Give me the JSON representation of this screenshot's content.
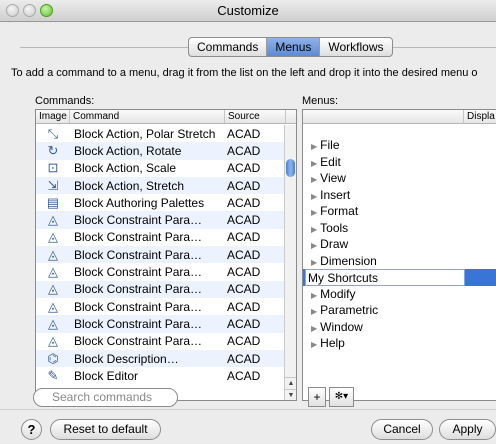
{
  "window": {
    "title": "Customize"
  },
  "tabs": [
    "Commands",
    "Menus",
    "Workflows"
  ],
  "active_tab": "Menus",
  "instruction": "To add a command to a menu, drag it from the list on the left and drop it into the desired menu o",
  "commands_panel": {
    "label": "Commands:",
    "columns": [
      "Image",
      "Command",
      "Source"
    ],
    "rows": [
      {
        "icon": "polar-stretch-icon",
        "command": "Block Action, Polar Stretch",
        "source": "ACAD"
      },
      {
        "icon": "rotate-icon",
        "command": "Block Action, Rotate",
        "source": "ACAD"
      },
      {
        "icon": "scale-icon",
        "command": "Block Action, Scale",
        "source": "ACAD"
      },
      {
        "icon": "stretch-icon",
        "command": "Block Action, Stretch",
        "source": "ACAD"
      },
      {
        "icon": "palettes-icon",
        "command": "Block Authoring Palettes",
        "source": "ACAD"
      },
      {
        "icon": "constraint-icon",
        "command": "Block Constraint Para…",
        "source": "ACAD"
      },
      {
        "icon": "constraint-icon",
        "command": "Block Constraint Para…",
        "source": "ACAD"
      },
      {
        "icon": "constraint-icon",
        "command": "Block Constraint Para…",
        "source": "ACAD"
      },
      {
        "icon": "constraint-icon",
        "command": "Block Constraint Para…",
        "source": "ACAD"
      },
      {
        "icon": "constraint-icon",
        "command": "Block Constraint Para…",
        "source": "ACAD"
      },
      {
        "icon": "constraint-icon",
        "command": "Block Constraint Para…",
        "source": "ACAD"
      },
      {
        "icon": "constraint-icon",
        "command": "Block Constraint Para…",
        "source": "ACAD"
      },
      {
        "icon": "constraint-icon",
        "command": "Block Constraint Para…",
        "source": "ACAD"
      },
      {
        "icon": "description-icon",
        "command": "Block Description…",
        "source": "ACAD"
      },
      {
        "icon": "block-editor-icon",
        "command": "Block Editor",
        "source": "ACAD"
      }
    ],
    "search_placeholder": "Search commands"
  },
  "menus_panel": {
    "label": "Menus:",
    "column": "Displa",
    "items": [
      "File",
      "Edit",
      "View",
      "Insert",
      "Format",
      "Tools",
      "Draw",
      "Dimension",
      "My Shortcuts",
      "Modify",
      "Parametric",
      "Window",
      "Help"
    ],
    "selected_item": "My Shortcuts",
    "add_button": "+",
    "gear_button": "✻▾"
  },
  "footer": {
    "help": "?",
    "reset": "Reset to default",
    "cancel": "Cancel",
    "apply": "Apply"
  },
  "colors": {
    "selection": "#3875d7",
    "alt_row": "#edf3fe"
  }
}
